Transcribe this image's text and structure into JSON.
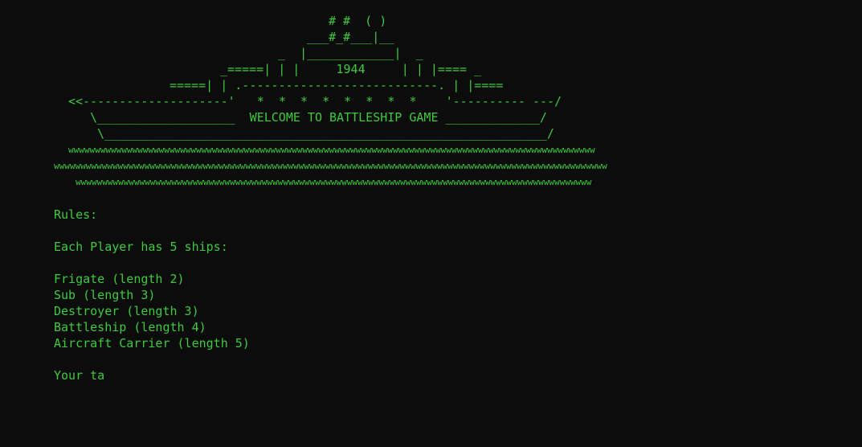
{
  "banner": {
    "lines": [
      "# #  ( )",
      "___#_#___|__",
      "_  |____________|  _",
      "_=====| | |     1944     | | |==== _",
      "=====| | .---------------------------. | |====",
      "<<--------------------'   *  *  *  *  *  *  *  *    '---------- ---/",
      "\\___________________  WELCOME TO BATTLESHIP GAME _____________/",
      "\\_____________________________________________________________/"
    ],
    "waves": [
      "wwwwwwwwwwwwwwwwwwwwwwwwwwwwwwwwwwwwwwwwwwwwwwwwwwwwwwwwwwwwwwwwwwwwwwwwwwwwwwwwwwwwwwwwwwwwwwwwwww",
      "wwwwwwwwwwwwwwwwwwwwwwwwwwwwwwwwwwwwwwwwwwwwwwwwwwwwwwwwwwwwwwwwwwwwwwwwwwwwwwwwwwwwwwwwwwwwwwwwwwwwwwww",
      "wwwwwwwwwwwwwwwwwwwwwwwwwwwwwwwwwwwwwwwwwwwwwwwwwwwwwwwwwwwwwwwwwwwwwwwwwwwwwwwwwwwwwwwwwwwwwwwww"
    ]
  },
  "rules": {
    "heading": "Rules:",
    "intro": "Each Player has 5 ships:",
    "ships": [
      "Frigate (length 2)",
      "Sub (length 3)",
      "Destroyer (length 3)",
      "Battleship (length 4)",
      "Aircraft Carrier (length 5)"
    ],
    "partial": "Your ta"
  }
}
